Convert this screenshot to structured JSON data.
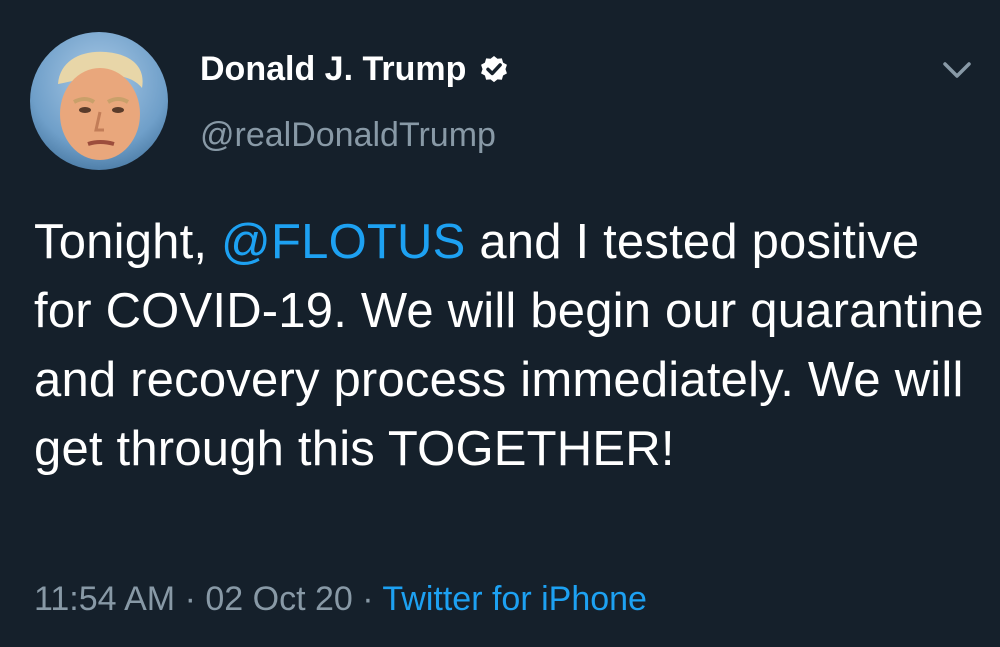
{
  "tweet": {
    "author": {
      "display_name": "Donald J. Trump",
      "handle": "@realDonaldTrump",
      "verified": true
    },
    "text": {
      "before_mention": "Tonight, ",
      "mention": "@FLOTUS",
      "after_mention": " and I tested positive for COVID-19. We will begin our quarantine and recovery process immediately. We will get through this TOGETHER!"
    },
    "meta": {
      "time": "11:54 AM",
      "separator": " · ",
      "date": "02 Oct 20",
      "source": "Twitter for iPhone"
    }
  },
  "colors": {
    "background": "#15202b",
    "text_primary": "#ffffff",
    "text_secondary": "#8899a6",
    "accent": "#1da1f2"
  },
  "icons": {
    "verified": "verified-badge-icon",
    "chevron": "chevron-down-icon"
  }
}
